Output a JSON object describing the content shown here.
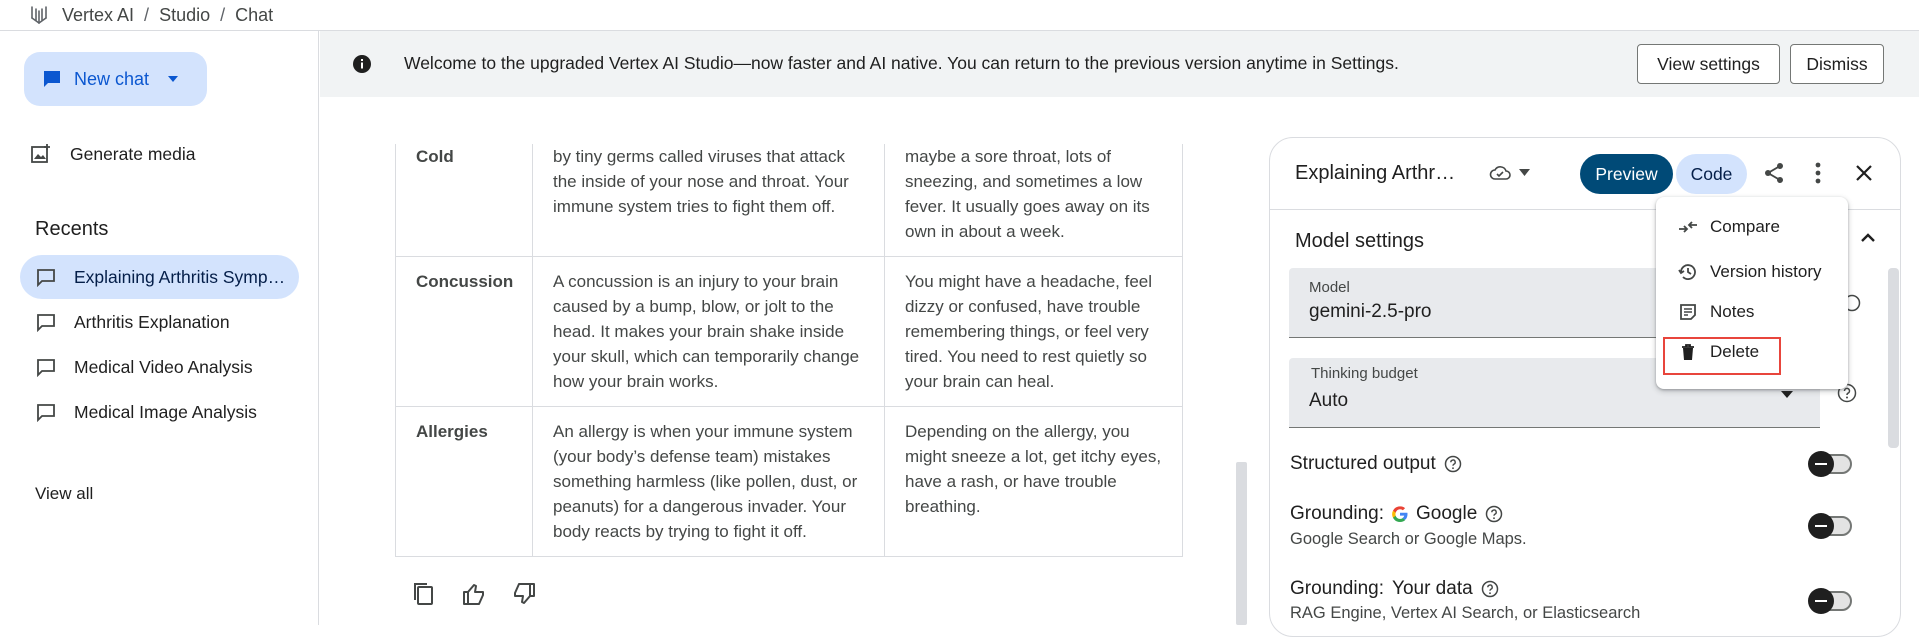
{
  "breadcrumb": {
    "app": "Vertex AI",
    "sep": "/",
    "studio": "Studio",
    "chat": "Chat"
  },
  "sidebar": {
    "new_chat": "New chat",
    "generate_media": "Generate media",
    "recents_title": "Recents",
    "recents": [
      {
        "label": "Explaining Arthritis Sympt…",
        "active": true
      },
      {
        "label": "Arthritis Explanation"
      },
      {
        "label": "Medical Video Analysis"
      },
      {
        "label": "Medical Image Analysis"
      }
    ],
    "view_all": "View all"
  },
  "banner": {
    "message": "Welcome to the upgraded Vertex AI Studio—now faster and AI native. You can return to the previous version anytime in Settings.",
    "view_settings": "View settings",
    "dismiss": "Dismiss"
  },
  "table": {
    "rows": [
      {
        "name": "Cold",
        "desc": "by tiny germs called viruses that attack the inside of your nose and throat. Your immune system tries to fight them off.",
        "symptoms": "maybe a sore throat, lots of sneezing, and sometimes a low fever. It usually goes away on its own in about a week."
      },
      {
        "name": "Concussion",
        "desc": "A concussion is an injury to your brain caused by a bump, blow, or jolt to the head. It makes your brain shake inside your skull, which can temporarily change how your brain works.",
        "symptoms": "You might have a headache, feel dizzy or confused, have trouble remembering things, or feel very tired. You need to rest quietly so your brain can heal."
      },
      {
        "name": "Allergies",
        "desc": "An allergy is when your immune system (your body’s defense team) mistakes something harmless (like pollen, dust, or peanuts) for a dangerous invader. Your body reacts by trying to fight it off.",
        "symptoms": "Depending on the allergy, you might sneeze a lot, get itchy eyes, have a rash, or have trouble breathing."
      }
    ]
  },
  "panel": {
    "title": "Explaining Arthr…",
    "preview": "Preview",
    "code": "Code",
    "model_settings": "Model settings",
    "model_label": "Model",
    "model_value": "gemini-2.5-pro",
    "thinking_label": "Thinking budget",
    "thinking_value": "Auto",
    "structured_output": "Structured output",
    "grounding_google_prefix": "Grounding:",
    "grounding_google": "Google",
    "grounding_google_sub": "Google Search or Google Maps.",
    "grounding_data_prefix": "Grounding:",
    "grounding_data": "Your data",
    "grounding_data_sub": "RAG Engine, Vertex AI Search, or Elasticsearch"
  },
  "menu": {
    "compare": "Compare",
    "version_history": "Version history",
    "notes": "Notes",
    "delete": "Delete"
  },
  "colors": {
    "accent": "#0b57d0",
    "chip": "#d3e3fd",
    "preview": "#004a77",
    "highlight": "#e8453c"
  }
}
